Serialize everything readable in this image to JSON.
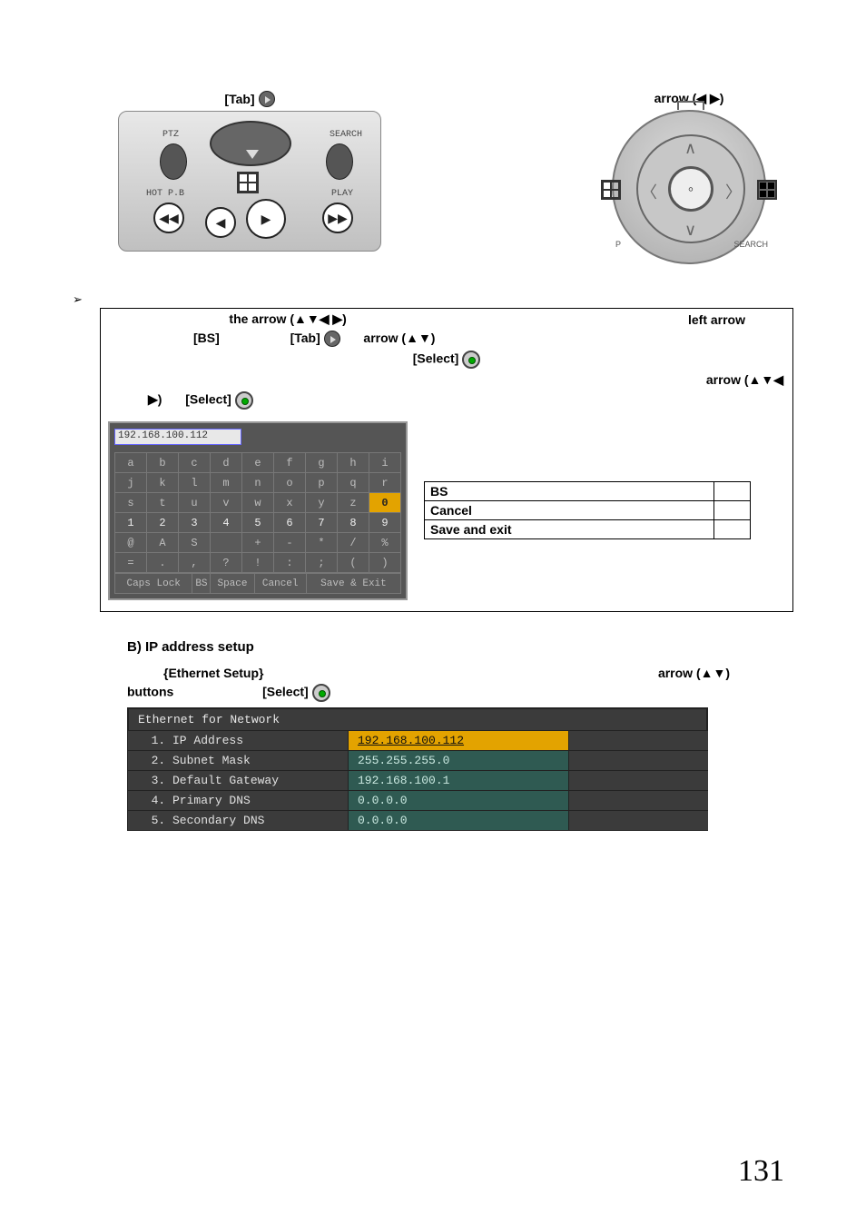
{
  "top_labels": {
    "tab_label": "[Tab]",
    "arrow_lr_label": "arrow (◀ ▶)"
  },
  "remote": {
    "ptz": "PTZ",
    "search": "SEARCH",
    "hotpb": "HOT P.B",
    "play": "PLAY"
  },
  "circle_pad": {
    "p_label": "P",
    "s_label": "SEARCH"
  },
  "rules": {
    "r1_left": "the arrow (▲▼◀ ▶)",
    "r1_right": "left arrow",
    "r2_bs": "[BS]",
    "r2_tab": "[Tab]",
    "r2_arrow_ud": "arrow (▲▼)",
    "r3_select": "[Select]",
    "r4_right": "arrow (▲▼◀",
    "r5_tri": "▶)",
    "r5_select": "[Select]"
  },
  "osk": {
    "input_value": "192.168.100.112",
    "rows_alpha": [
      [
        "a",
        "b",
        "c",
        "d",
        "e",
        "f",
        "g",
        "h",
        "i"
      ],
      [
        "j",
        "k",
        "l",
        "m",
        "n",
        "o",
        "p",
        "q",
        "r"
      ],
      [
        "s",
        "t",
        "u",
        "v",
        "w",
        "x",
        "y",
        "z",
        "0"
      ],
      [
        "1",
        "2",
        "3",
        "4",
        "5",
        "6",
        "7",
        "8",
        "9"
      ],
      [
        "@",
        "A",
        "S",
        "",
        "+",
        "-",
        "*",
        "/",
        "%"
      ],
      [
        "=",
        ".",
        ",",
        "?",
        "!",
        ":",
        ";",
        "(",
        ")"
      ]
    ],
    "bottom": {
      "caps": "Caps Lock",
      "bs": "BS",
      "space": "Space",
      "cancel": "Cancel",
      "save": "Save & Exit"
    }
  },
  "explain": {
    "rows": [
      {
        "k": "BS",
        "v": ""
      },
      {
        "k": "Cancel",
        "v": ""
      },
      {
        "k": "Save and exit",
        "v": ""
      }
    ]
  },
  "section_b": {
    "title": "B) IP address setup",
    "line1_left": "{Ethernet Setup}",
    "line1_right": "arrow (▲▼)",
    "line2_left": "buttons",
    "line2_select": "[Select]"
  },
  "eth": {
    "title": "Ethernet for Network",
    "rows": [
      {
        "n": "1.",
        "label": "IP Address",
        "value": "192.168.100.112",
        "hl": true
      },
      {
        "n": "2.",
        "label": "Subnet Mask",
        "value": "255.255.255.0",
        "hl": false
      },
      {
        "n": "3.",
        "label": "Default Gateway",
        "value": "192.168.100.1",
        "hl": false
      },
      {
        "n": "4.",
        "label": "Primary DNS",
        "value": "0.0.0.0",
        "hl": false
      },
      {
        "n": "5.",
        "label": "Secondary DNS",
        "value": "0.0.0.0",
        "hl": false
      }
    ]
  },
  "page_number": "131"
}
